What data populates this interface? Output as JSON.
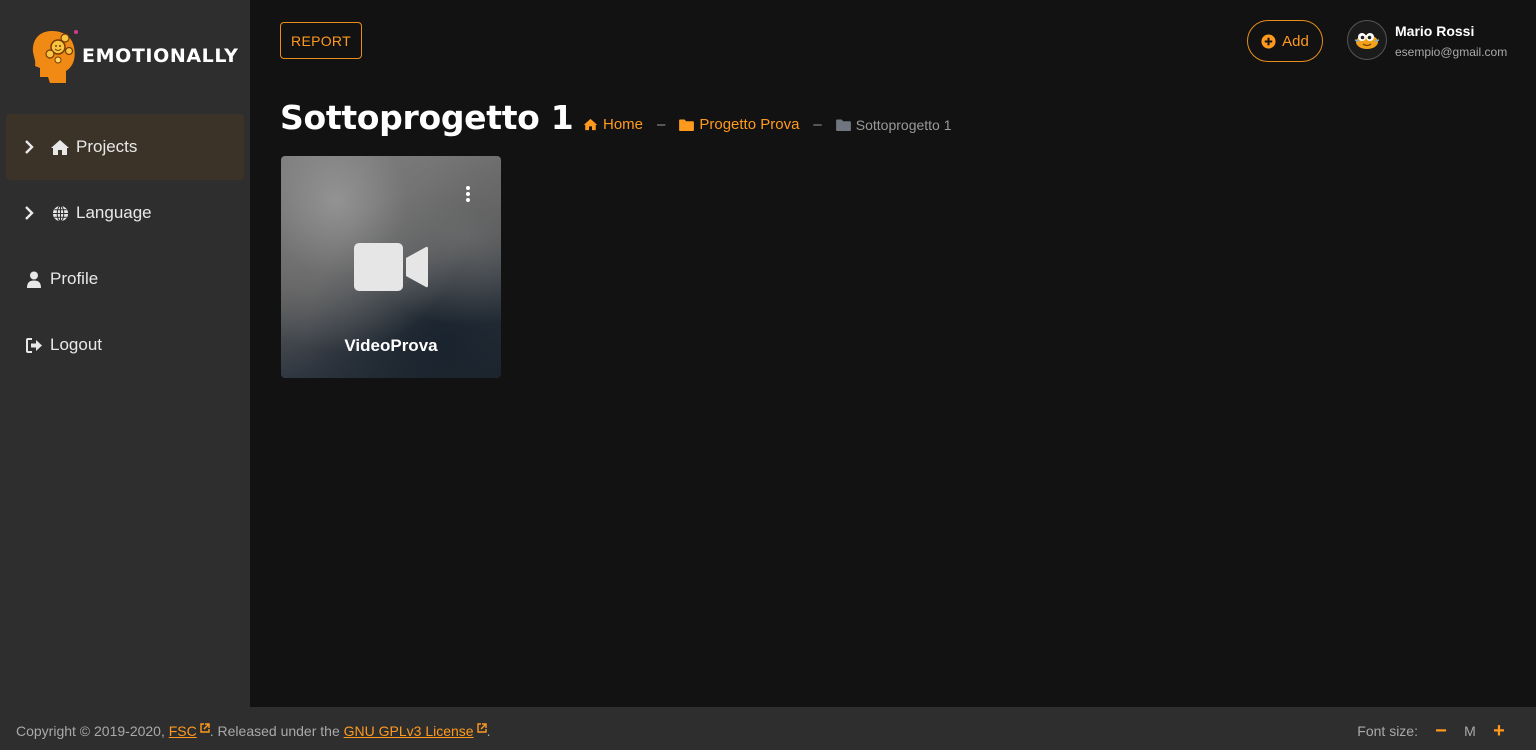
{
  "app": {
    "brand": "EMOTIONALLY"
  },
  "sidebar": {
    "items": [
      {
        "label": "Projects",
        "icon": "home-icon",
        "expandable": true,
        "active": true
      },
      {
        "label": "Language",
        "icon": "globe-icon",
        "expandable": true,
        "active": false
      },
      {
        "label": "Profile",
        "icon": "user-icon",
        "expandable": false,
        "active": false
      },
      {
        "label": "Logout",
        "icon": "logout-icon",
        "expandable": false,
        "active": false
      }
    ]
  },
  "header": {
    "report_label": "REPORT",
    "add_label": "Add",
    "user": {
      "name": "Mario Rossi",
      "email": "esempio@gmail.com"
    }
  },
  "page": {
    "title": "Sottoprogetto 1",
    "breadcrumb": [
      {
        "label": "Home",
        "icon": "home-icon"
      },
      {
        "label": "Progetto Prova",
        "icon": "folder-icon"
      },
      {
        "label": "Sottoprogetto 1",
        "icon": "folder-icon"
      }
    ],
    "breadcrumb_separator": "–"
  },
  "cards": [
    {
      "title": "VideoProva",
      "icon": "video-camera-icon"
    }
  ],
  "footer": {
    "copyright_text": "Copyright © 2019-2020, ",
    "fsc_link": "FSC",
    "released_text": ". Released under the ",
    "license_link": "GNU GPLv3 License",
    "end_text": ".",
    "font_size_label": "Font size:",
    "font_size_value": "M",
    "decrease_symbol": "−",
    "increase_symbol": "+"
  },
  "colors": {
    "accent": "#ff9a1f",
    "background": "#121212",
    "sidebar": "#2e2e2e",
    "active_item": "#3b3328"
  }
}
